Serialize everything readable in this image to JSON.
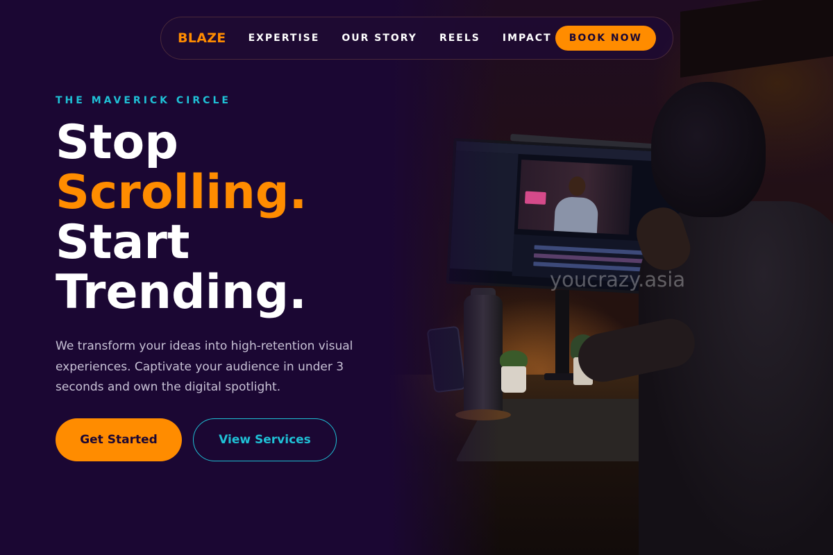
{
  "nav": {
    "brand": "BLAZE",
    "links": [
      "EXPERTISE",
      "OUR STORY",
      "REELS",
      "IMPACT"
    ],
    "cta": "BOOK NOW"
  },
  "hero": {
    "eyebrow": "THE MAVERICK CIRCLE",
    "headline": {
      "line1": "Stop",
      "line2": "Scrolling.",
      "line3": "Start",
      "line4": "Trending."
    },
    "description": "We transform your ideas into high-retention visual experiences. Captivate your audience in under 3 seconds and own the digital spotlight.",
    "primary_cta": "Get Started",
    "secondary_cta": "View Services"
  },
  "watermark": "youcrazy.asia",
  "colors": {
    "background": "#1b0733",
    "accent_orange": "#ff8c00",
    "accent_cyan": "#1fc1d6",
    "text_primary": "#ffffff",
    "text_muted": "#c8c2d6"
  }
}
